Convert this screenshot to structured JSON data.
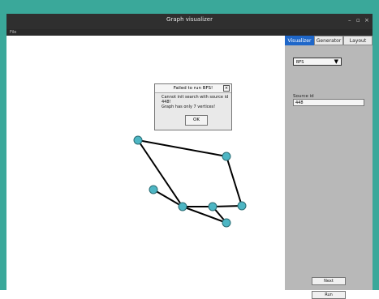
{
  "window": {
    "title": "Graph visualizer",
    "controls": {
      "minimize": "–",
      "maximize": "▫",
      "close": "×"
    }
  },
  "menu": {
    "file": "File"
  },
  "tabs": [
    {
      "label": "Visualizer"
    },
    {
      "label": "Generator"
    },
    {
      "label": "Layout"
    }
  ],
  "side": {
    "algo_value": "BFS",
    "source_label": "Source id",
    "source_value": "448",
    "next_label": "Next",
    "run_label": "Run"
  },
  "dialog": {
    "title": "Failed to run BFS!",
    "line1": "Cannot init search with source id",
    "line2": "448!",
    "line3": "Graph has only 7 vertices!",
    "ok_label": "OK"
  },
  "colors": {
    "node_fill": "#4db6c4",
    "node_stroke": "#2b6c73",
    "edge": "#000000",
    "active_tab": "#1f67c9"
  }
}
